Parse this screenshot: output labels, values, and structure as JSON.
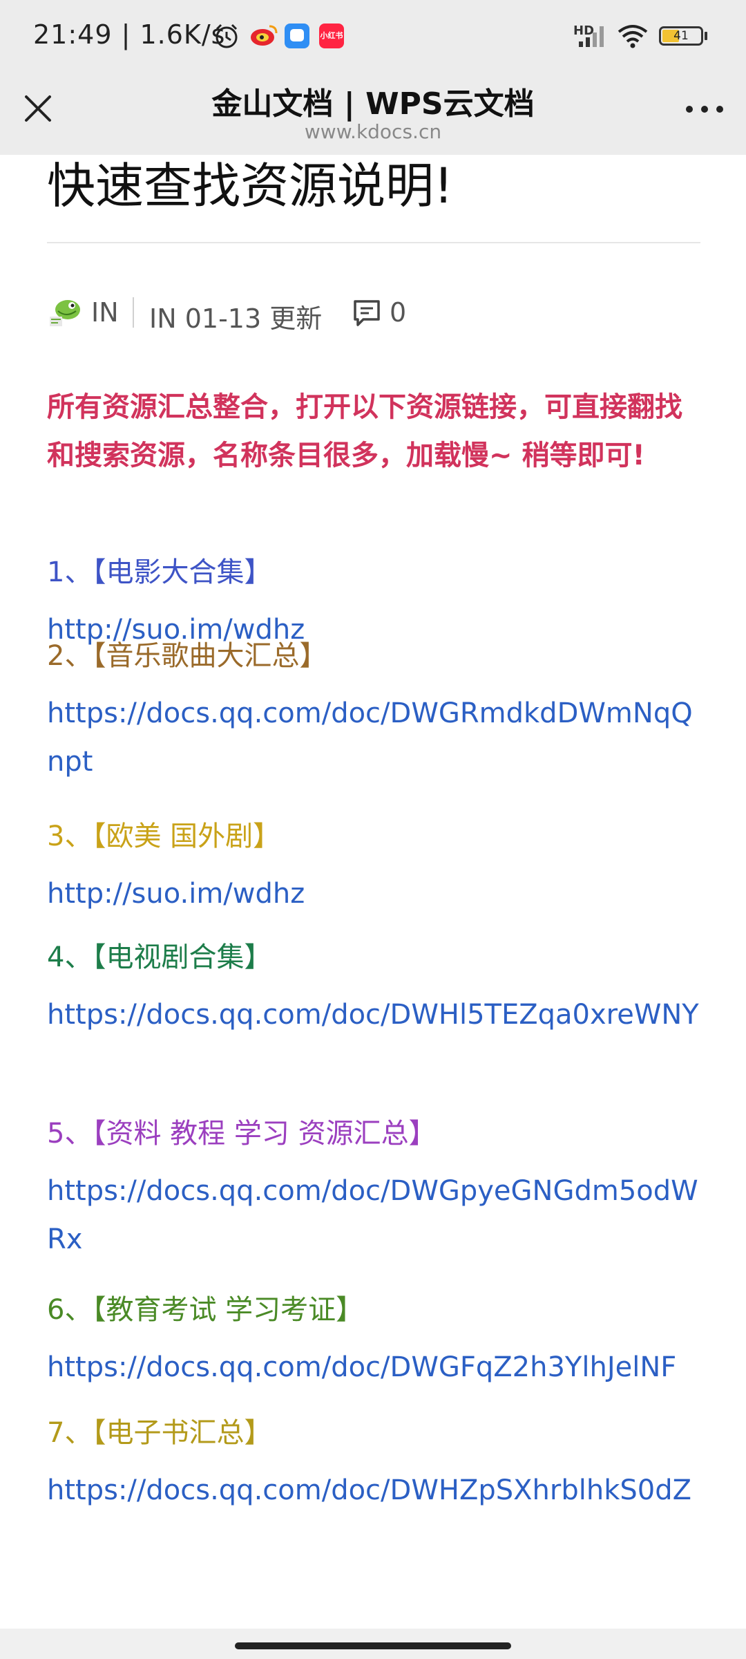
{
  "status_bar": {
    "time_speed": "21:49 | 1.6K/s",
    "battery": "41",
    "network": "HD",
    "app_icons": [
      "alarm-icon",
      "weibo-icon",
      "chat-icon",
      "xiaohongshu-icon"
    ],
    "xiaohongshu_label": "小红书"
  },
  "nav": {
    "title": "金山文档 | WPS云文档",
    "url": "www.kdocs.cn"
  },
  "article": {
    "title": "快速查找资源说明!",
    "author": "IN",
    "updated": "IN 01-13 更新",
    "comment_count": "0",
    "intro": "所有资源汇总整合，打开以下资源链接，可直接翻找和搜索资源，名称条目很多，加载慢~ 稍等即可!",
    "entries": [
      {
        "title": "1、【电影大合集】",
        "url": "http://suo.im/wdhz",
        "color": "#3e54c6"
      },
      {
        "title": "2、【音乐歌曲大汇总】",
        "url": "https://docs.qq.com/doc/DWGRmdkdDWmNqQnpt",
        "color": "#9a6a2a"
      },
      {
        "title": "3、【欧美 国外剧】",
        "url": "http://suo.im/wdhz",
        "color": "#c9a218"
      },
      {
        "title": "4、【电视剧合集】",
        "url": "https://docs.qq.com/doc/DWHl5TEZqa0xreWNY",
        "color": "#1d7d4a"
      },
      {
        "title": "5、【资料 教程 学习 资源汇总】",
        "url": "https://docs.qq.com/doc/DWGpyeGNGdm5odWRx",
        "color": "#9b3fbf"
      },
      {
        "title": "6、【教育考试 学习考证】",
        "url": "https://docs.qq.com/doc/DWGFqZ2h3YlhJelNF",
        "color": "#4a8a26"
      },
      {
        "title": "7、【电子书汇总】",
        "url": "https://docs.qq.com/doc/DWHZpSXhrblhkS0dZ",
        "color": "#b39a1a"
      }
    ]
  },
  "colors": {
    "intro": "#d1335c",
    "link": "#2b5fc4",
    "nav_bg": "#ececec"
  }
}
